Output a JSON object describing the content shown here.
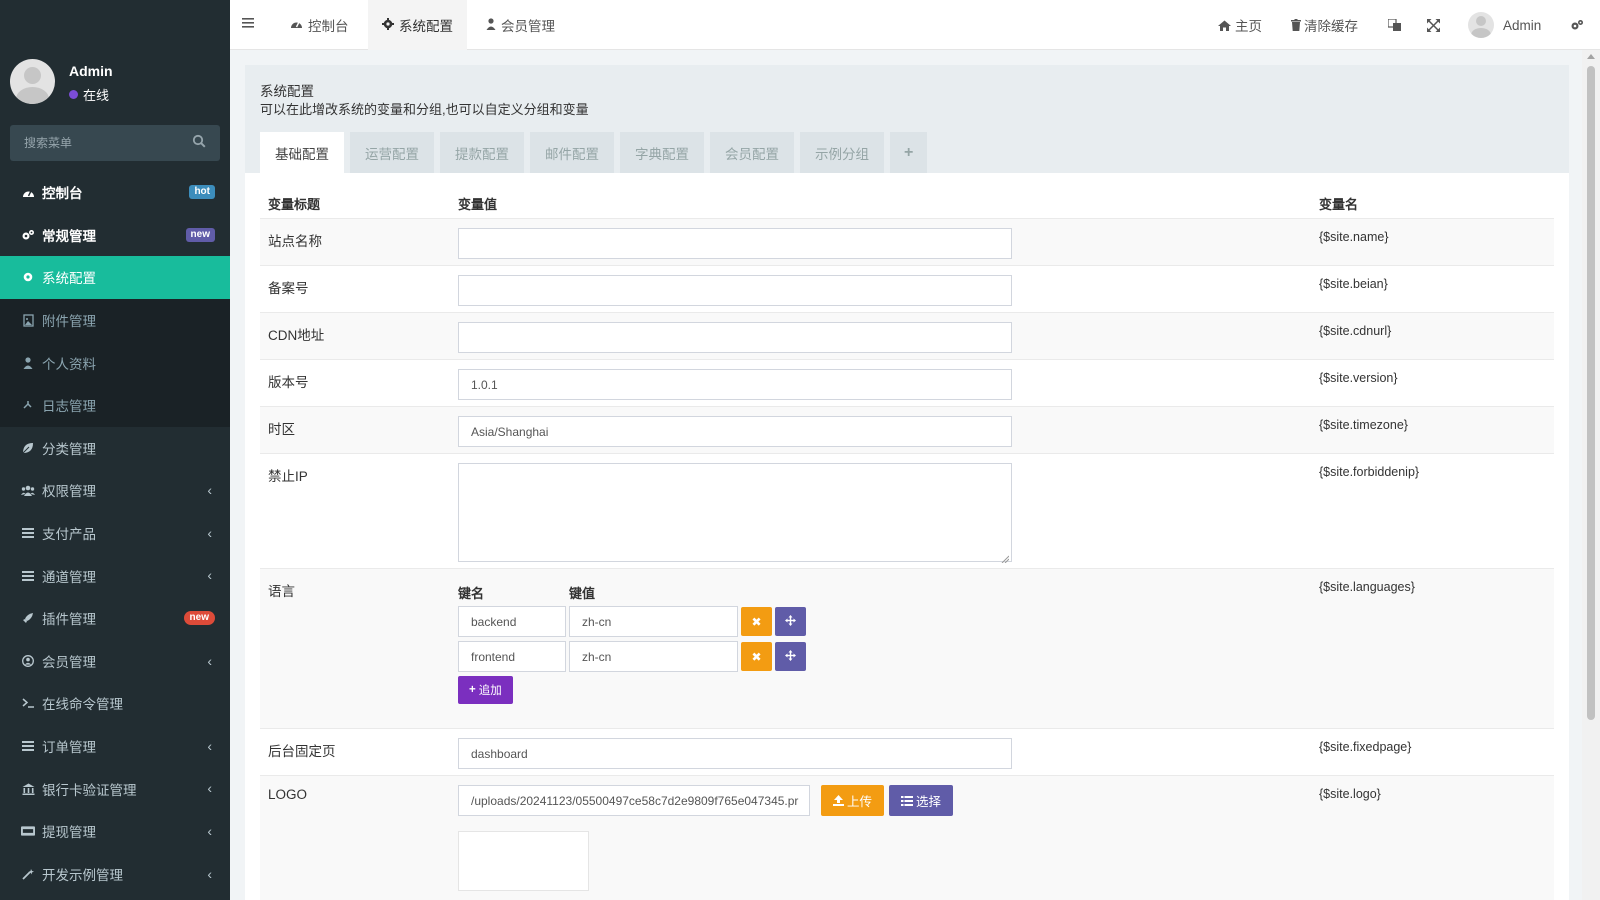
{
  "user": {
    "name": "Admin",
    "status": "在线"
  },
  "sidebar": {
    "search_placeholder": "搜索菜单",
    "items": [
      {
        "label": "控制台",
        "badge": "hot"
      },
      {
        "label": "常规管理",
        "badge": "new"
      },
      {
        "label": "系统配置"
      },
      {
        "label": "附件管理"
      },
      {
        "label": "个人资料"
      },
      {
        "label": "日志管理"
      },
      {
        "label": "分类管理"
      },
      {
        "label": "权限管理"
      },
      {
        "label": "支付产品"
      },
      {
        "label": "通道管理"
      },
      {
        "label": "插件管理",
        "badge": "new"
      },
      {
        "label": "会员管理"
      },
      {
        "label": "在线命令管理"
      },
      {
        "label": "订单管理"
      },
      {
        "label": "银行卡验证管理"
      },
      {
        "label": "提现管理"
      },
      {
        "label": "开发示例管理"
      }
    ]
  },
  "header": {
    "tabs": [
      {
        "label": "控制台"
      },
      {
        "label": "系统配置"
      },
      {
        "label": "会员管理"
      }
    ],
    "home": "主页",
    "clear_cache": "清除缓存",
    "user_name": "Admin"
  },
  "panel": {
    "title": "系统配置",
    "description": "可以在此增改系统的变量和分组,也可以自定义分组和变量",
    "tabs": [
      "基础配置",
      "运营配置",
      "提款配置",
      "邮件配置",
      "字典配置",
      "会员配置",
      "示例分组",
      "+"
    ]
  },
  "table": {
    "headers": {
      "title": "变量标题",
      "value": "变量值",
      "name": "变量名"
    },
    "rows": [
      {
        "title": "站点名称",
        "value": "",
        "name": "{$site.name}"
      },
      {
        "title": "备案号",
        "value": "",
        "name": "{$site.beian}"
      },
      {
        "title": "CDN地址",
        "value": "",
        "name": "{$site.cdnurl}"
      },
      {
        "title": "版本号",
        "value": "1.0.1",
        "name": "{$site.version}"
      },
      {
        "title": "时区",
        "value": "Asia/Shanghai",
        "name": "{$site.timezone}"
      },
      {
        "title": "禁止IP",
        "value": "",
        "name": "{$site.forbiddenip}"
      },
      {
        "title": "语言",
        "name": "{$site.languages}"
      },
      {
        "title": "后台固定页",
        "value": "dashboard",
        "name": "{$site.fixedpage}"
      },
      {
        "title": "LOGO",
        "value": "/uploads/20241123/05500497ce58c7d2e9809f765e047345.pr",
        "name": "{$site.logo}"
      }
    ],
    "languages": {
      "key_header": "键名",
      "value_header": "键值",
      "pairs": [
        {
          "key": "backend",
          "value": "zh-cn"
        },
        {
          "key": "frontend",
          "value": "zh-cn"
        }
      ],
      "add_label": "追加"
    },
    "logo": {
      "upload_label": "上传",
      "select_label": "选择"
    }
  },
  "colors": {
    "sidebar_bg": "#222d32",
    "active": "#18bc9c",
    "warning": "#f39c12",
    "purple": "#605ca8"
  }
}
